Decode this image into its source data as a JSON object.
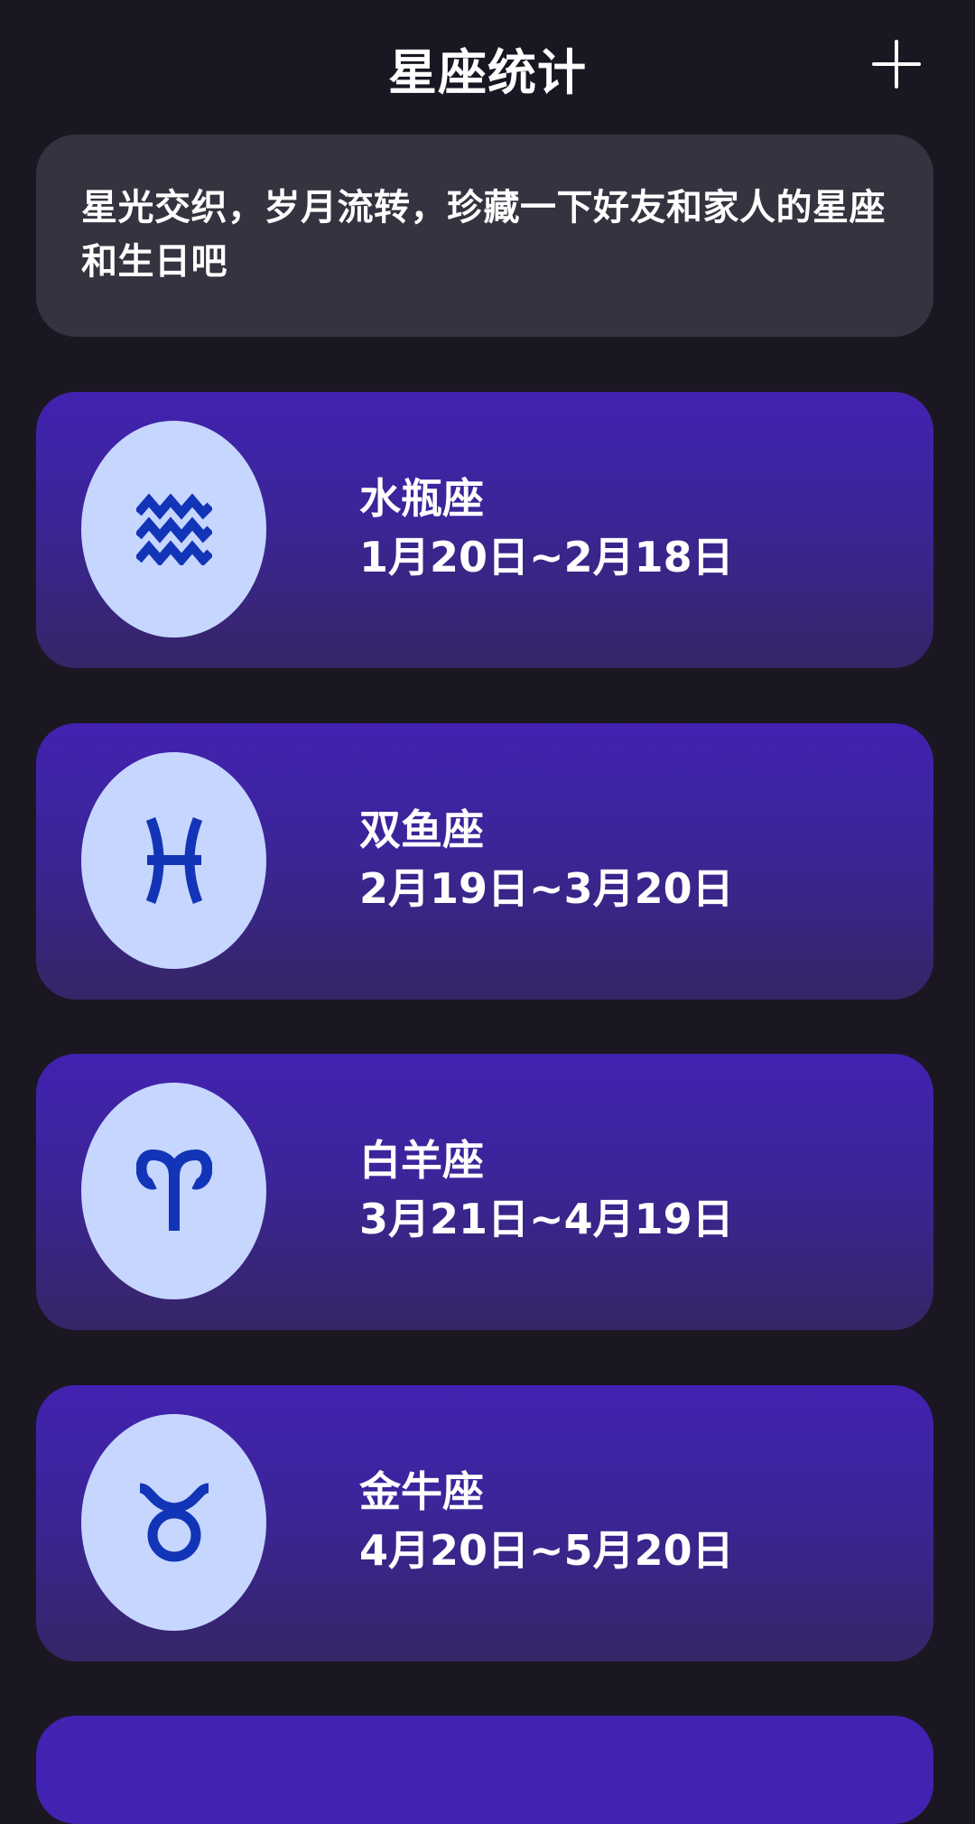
{
  "header": {
    "title": "星座统计",
    "add_icon": "plus-icon"
  },
  "intro": {
    "text": "星光交织，岁月流转，珍藏一下好友和家人的星座和生日吧"
  },
  "colors": {
    "background": "#1b1722",
    "intro_card": "#36323f",
    "card_gradient_top": "#4222b0",
    "card_gradient_bottom": "#362566",
    "icon_circle": "#c7d6ff",
    "icon_glyph": "#1235b8"
  },
  "zodiacs": [
    {
      "name": "水瓶座",
      "dates": "1月20日~2月18日",
      "icon": "aquarius-icon"
    },
    {
      "name": "双鱼座",
      "dates": "2月19日~3月20日",
      "icon": "pisces-icon"
    },
    {
      "name": "白羊座",
      "dates": "3月21日~4月19日",
      "icon": "aries-icon"
    },
    {
      "name": "金牛座",
      "dates": "4月20日~5月20日",
      "icon": "taurus-icon"
    }
  ]
}
